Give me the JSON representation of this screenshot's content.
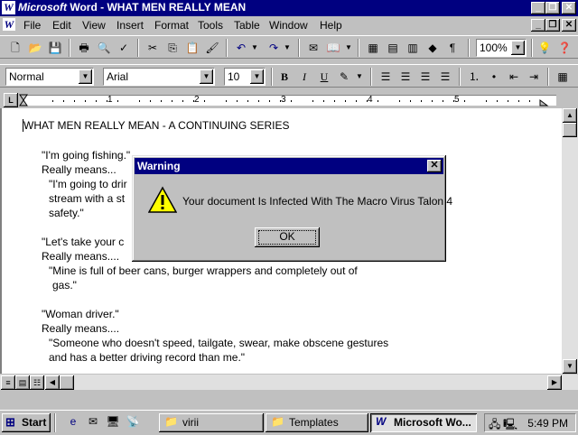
{
  "window": {
    "title_brand": "Microsoft",
    "title_rest": " Word - WHAT MEN REALLY MEAN",
    "icons": [
      "word-logo-icon",
      "minimize-icon",
      "restore-icon",
      "close-icon"
    ]
  },
  "menu": {
    "items": [
      "File",
      "Edit",
      "View",
      "Insert",
      "Format",
      "Tools",
      "Table",
      "Window",
      "Help"
    ]
  },
  "standard_toolbar": {
    "zoom": "100%"
  },
  "formatting_toolbar": {
    "style": "Normal",
    "font": "Arial",
    "size": "10",
    "bold": "B",
    "italic": "I",
    "underline": "U"
  },
  "document": {
    "lines": [
      "WHAT MEN REALLY MEAN - A CONTINUING SERIES",
      "\"I'm going fishing.\"",
      "Really means...",
      "\"I'm going to drir",
      "stream with a st",
      "safety.\"",
      "\"Let's take your c",
      "Really means....",
      "\"Mine is full of beer cans, burger wrappers and completely out of",
      "gas.\"",
      "\"Woman driver.\"",
      "Really means....",
      "\"Someone who doesn't speed, tailgate, swear, make obscene gestures",
      "and has a better driving record than me.\""
    ]
  },
  "dialog": {
    "title": "Warning",
    "message": "Your document Is Infected With The Macro Virus Talon 4",
    "ok_label": "OK",
    "icon": "warning-icon"
  },
  "taskbar": {
    "start_label": "Start",
    "tasks": [
      "virii",
      "Templates",
      "Microsoft Wo..."
    ],
    "clock": "5:49 PM"
  },
  "ruler": {
    "numbers": [
      "1",
      "2",
      "3",
      "4",
      "5"
    ]
  }
}
